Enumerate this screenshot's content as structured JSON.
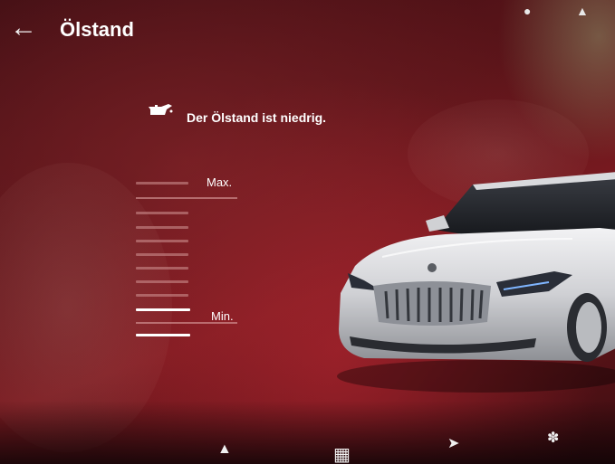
{
  "header": {
    "back_icon": "arrow-left-icon",
    "title": "Ölstand"
  },
  "status": {
    "icon": "oil-can-icon",
    "message": "Der Ölstand ist niedrig."
  },
  "gauge": {
    "max_label": "Max.",
    "min_label": "Min.",
    "level_fraction": 0.15
  },
  "colors": {
    "accent": "#7a1a20",
    "text": "#ffffff",
    "gauge_filled": "#ffffff",
    "gauge_empty": "#d29696"
  },
  "bottom_bar": {
    "icons": [
      "seat-icon",
      "apps-grid-icon",
      "navigation-arrow-icon",
      "fan-icon"
    ]
  }
}
